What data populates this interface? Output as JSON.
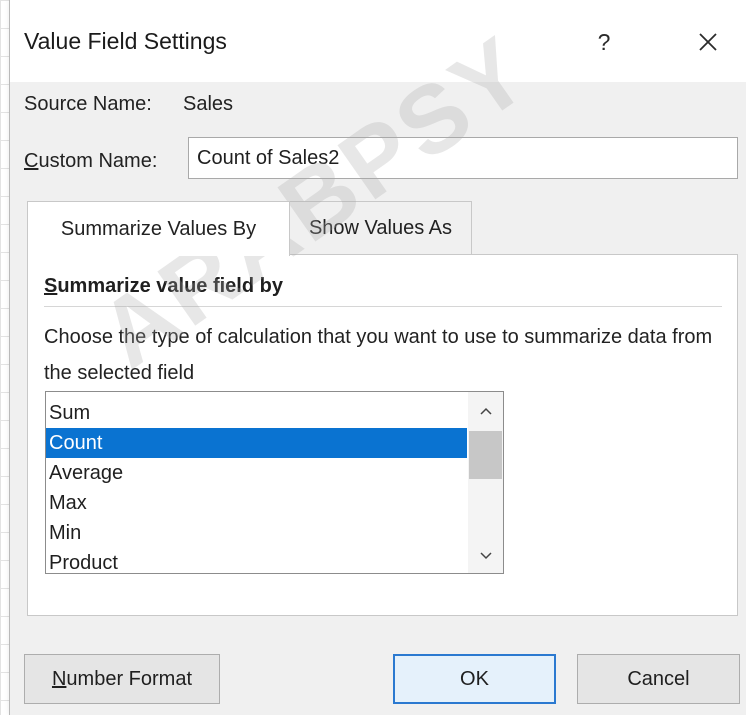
{
  "dialog": {
    "title": "Value Field Settings",
    "help_label": "?",
    "close_icon": "close-icon"
  },
  "source": {
    "label": "Source Name:",
    "value": "Sales"
  },
  "custom_name": {
    "label_accel": "C",
    "label_rest": "ustom Name:",
    "value": "Count of Sales2"
  },
  "tabs": [
    {
      "label": "Summarize Values By",
      "active": true
    },
    {
      "label": "Show Values As",
      "active": false
    }
  ],
  "panel": {
    "heading_accel": "S",
    "heading_rest": "ummarize value field by",
    "description": "Choose the type of calculation that you want to use to summarize data from the selected field",
    "items": [
      {
        "label": "Sum"
      },
      {
        "label": "Count"
      },
      {
        "label": "Average"
      },
      {
        "label": "Max"
      },
      {
        "label": "Min"
      },
      {
        "label": "Product"
      }
    ],
    "selected_index": 1
  },
  "buttons": {
    "number_format_accel": "N",
    "number_format_rest": "umber Format",
    "ok": "OK",
    "cancel": "Cancel"
  },
  "watermark": "ARABPSY",
  "colors": {
    "selection": "#0a73d1",
    "ok_border": "#2b79d0"
  }
}
